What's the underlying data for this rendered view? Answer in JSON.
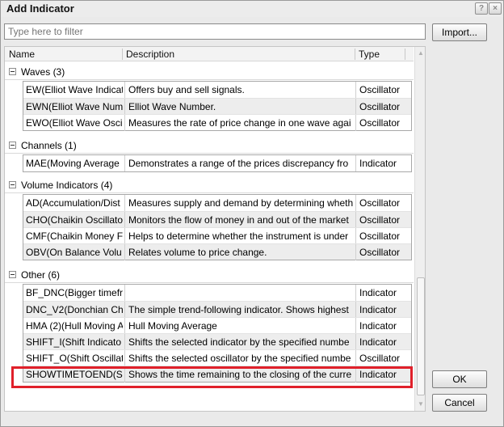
{
  "window": {
    "title": "Add Indicator",
    "help_label": "?",
    "close_label": "×"
  },
  "filter": {
    "placeholder": "Type here to filter"
  },
  "buttons": {
    "import": "Import...",
    "ok": "OK",
    "cancel": "Cancel"
  },
  "columns": {
    "name": "Name",
    "description": "Description",
    "type": "Type"
  },
  "groups": [
    {
      "name": "Waves (3)",
      "rows": [
        {
          "name": "EW(Elliot Wave Indicat",
          "description": "Offers buy and sell signals.",
          "type": "Oscillator"
        },
        {
          "name": "EWN(Elliot Wave Numl",
          "description": "Elliot Wave Number.",
          "type": "Oscillator"
        },
        {
          "name": "EWO(Elliot Wave Oscil",
          "description": "Measures the rate of price change in one wave agai",
          "type": "Oscillator"
        }
      ]
    },
    {
      "name": "Channels (1)",
      "rows": [
        {
          "name": "MAE(Moving Average",
          "description": "Demonstrates a range of the prices discrepancy fro",
          "type": "Indicator"
        }
      ]
    },
    {
      "name": "Volume Indicators (4)",
      "rows": [
        {
          "name": "AD(Accumulation/Dist",
          "description": "Measures supply and demand by determining wheth",
          "type": "Oscillator"
        },
        {
          "name": "CHO(Chaikin Oscillato",
          "description": "Monitors the flow of money in and out of the market",
          "type": "Oscillator"
        },
        {
          "name": "CMF(Chaikin Money Fl",
          "description": "Helps to determine whether the instrument is under",
          "type": "Oscillator"
        },
        {
          "name": "OBV(On Balance Volu",
          "description": "Relates volume to price change.",
          "type": "Oscillator"
        }
      ]
    },
    {
      "name": "Other (6)",
      "rows": [
        {
          "name": "BF_DNC(Bigger timefr",
          "description": "",
          "type": "Indicator"
        },
        {
          "name": "DNC_V2(Donchian Ch",
          "description": "The simple trend-following indicator. Shows highest",
          "type": "Indicator"
        },
        {
          "name": "HMA (2)(Hull Moving A",
          "description": "Hull Moving Average",
          "type": "Indicator"
        },
        {
          "name": "SHIFT_I(Shift Indicato",
          "description": "Shifts the selected indicator by the specified numbe",
          "type": "Indicator"
        },
        {
          "name": "SHIFT_O(Shift Oscillat",
          "description": "Shifts the selected oscillator by the specified numbe",
          "type": "Oscillator"
        },
        {
          "name": "SHOWTIMETOEND(Sh",
          "description": "Shows the time remaining to the closing of the curre",
          "type": "Indicator"
        }
      ]
    }
  ],
  "highlight_color": "#e0202a"
}
